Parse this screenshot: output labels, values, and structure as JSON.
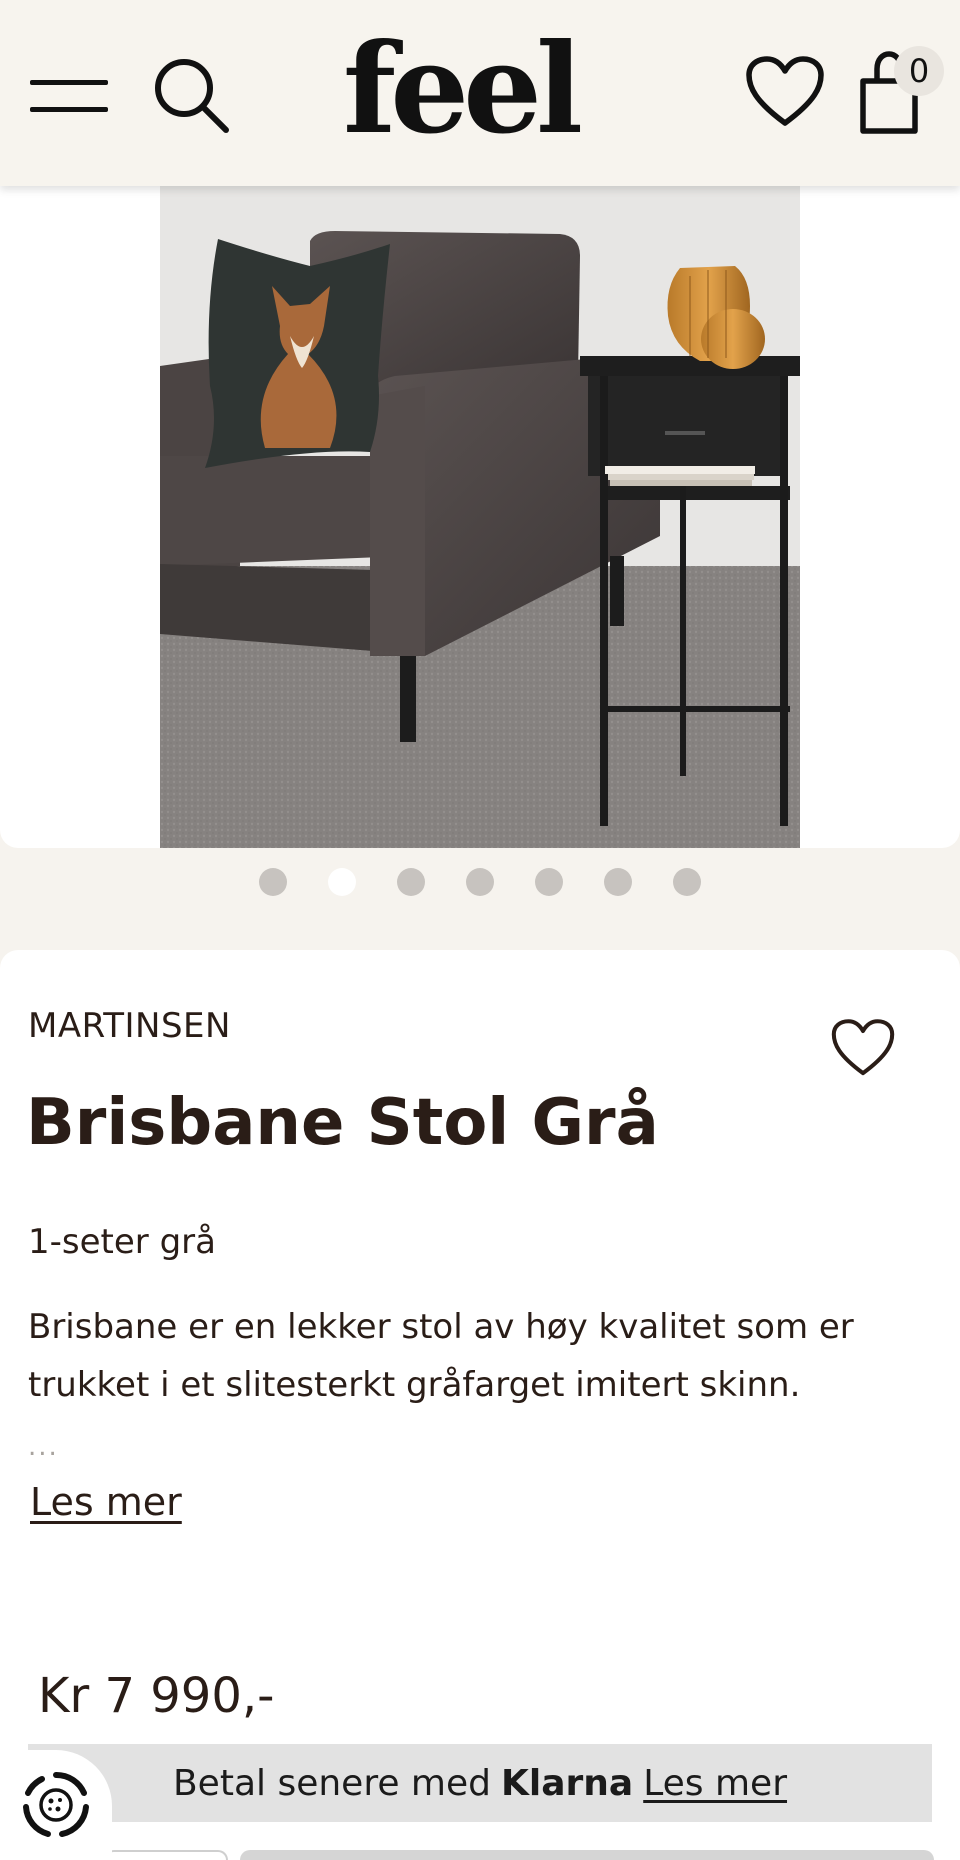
{
  "header": {
    "logo": "feel",
    "cart_count": "0"
  },
  "gallery": {
    "image_alt": "Brisbane Stol Grå i stue med fotpute og sidebord",
    "slide_count": 7,
    "active_index": 1
  },
  "product": {
    "brand": "MARTINSEN",
    "title": "Brisbane Stol Grå",
    "subtitle": "1-seter grå",
    "description": "Brisbane er en lekker stol av høy kvalitet som er trukket i et slitesterkt gråfarget imitert skinn.",
    "ellipsis": "...",
    "read_more": "Les mer",
    "price": "Kr 7 990,-"
  },
  "klarna": {
    "prefix": "Betal senere med",
    "brand": "Klarna",
    "link": "Les mer"
  },
  "icons": {
    "menu": "hamburger-menu-icon",
    "search": "search-icon",
    "wishlist": "heart-icon",
    "cart": "shopping-bag-icon",
    "cookie": "cookie-settings-icon"
  },
  "colors": {
    "header_bg": "#f7f4ee",
    "page_bg": "#f6f3ee",
    "text": "#2a1d17",
    "klarna_bg": "#e2e2e2"
  }
}
